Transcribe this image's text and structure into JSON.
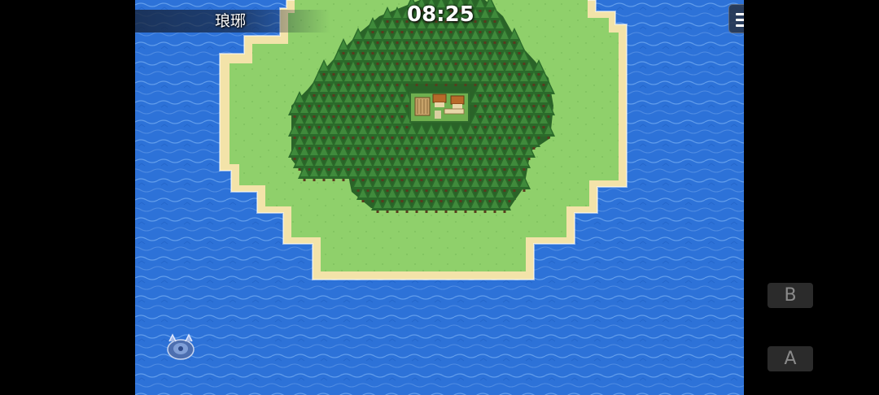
{
  "hud": {
    "location_name": "琅琊",
    "clock": "08:25",
    "menu_icon": "hamburger-menu-icon"
  },
  "controls": {
    "b_label": "B",
    "a_label": "A"
  },
  "colors": {
    "ocean": "#2a6fd6",
    "sand": "#f1e2a8",
    "grass": "#8ccf6a",
    "forest": "#2f6a2c"
  }
}
